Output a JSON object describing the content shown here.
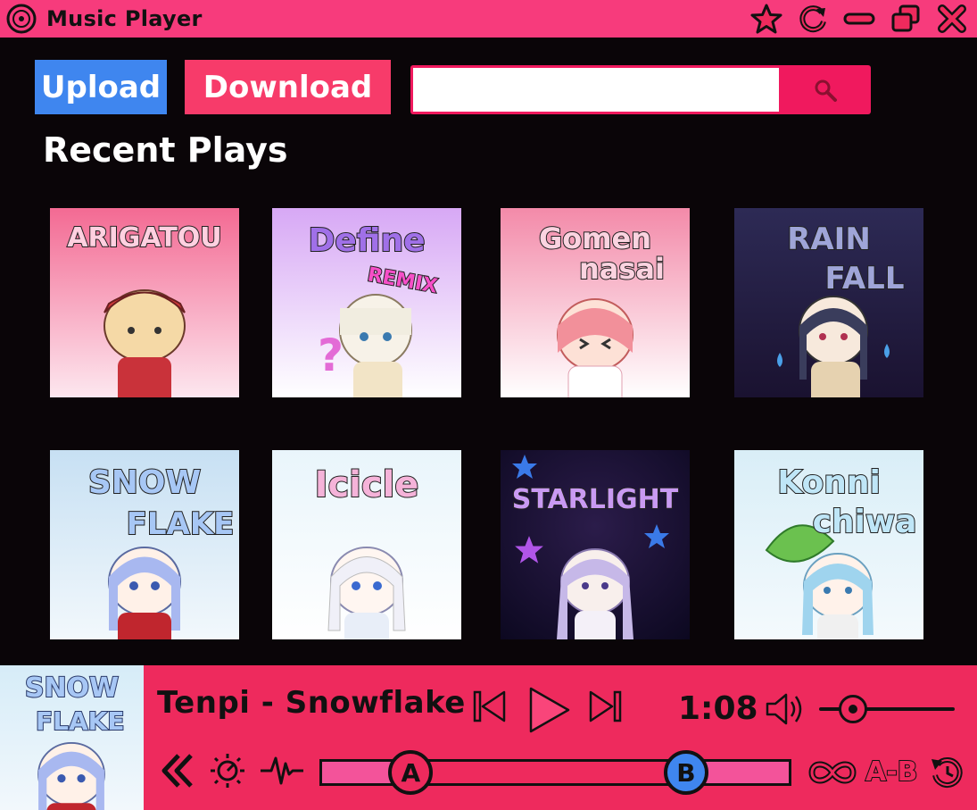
{
  "window": {
    "title": "Music Player",
    "controls": [
      "star-icon",
      "refresh-icon",
      "minimize-icon",
      "restore-icon",
      "close-icon"
    ]
  },
  "toolbar": {
    "upload_label": "Upload",
    "download_label": "Download",
    "search": {
      "value": "",
      "placeholder": ""
    }
  },
  "recent": {
    "title": "Recent Plays",
    "albums": [
      {
        "cover_text": "ARIGATOU"
      },
      {
        "cover_text": "Define",
        "cover_subtext": "REMIX"
      },
      {
        "cover_text": "Gomen",
        "cover_subtext": "nasai"
      },
      {
        "cover_text": "RAIN",
        "cover_subtext": "FALL"
      },
      {
        "cover_text": "SNOW",
        "cover_subtext": "FLAKE"
      },
      {
        "cover_text": "Icicle"
      },
      {
        "cover_text": "STARLIGHT"
      },
      {
        "cover_text": "Konni",
        "cover_subtext": "chiwa"
      }
    ]
  },
  "player": {
    "cover_text": "SNOW",
    "cover_subtext": "FLAKE",
    "track": "Tenpi - Snowflake",
    "time": "1:08",
    "volume": 0.25,
    "marker_a_label": "A",
    "marker_b_label": "B",
    "marker_a_position": 0.19,
    "marker_b_position": 0.78,
    "ab_label": "A-B",
    "colors": {
      "accent": "#ee2a5d",
      "blue": "#3f86ef",
      "pink": "#f3539a"
    }
  }
}
